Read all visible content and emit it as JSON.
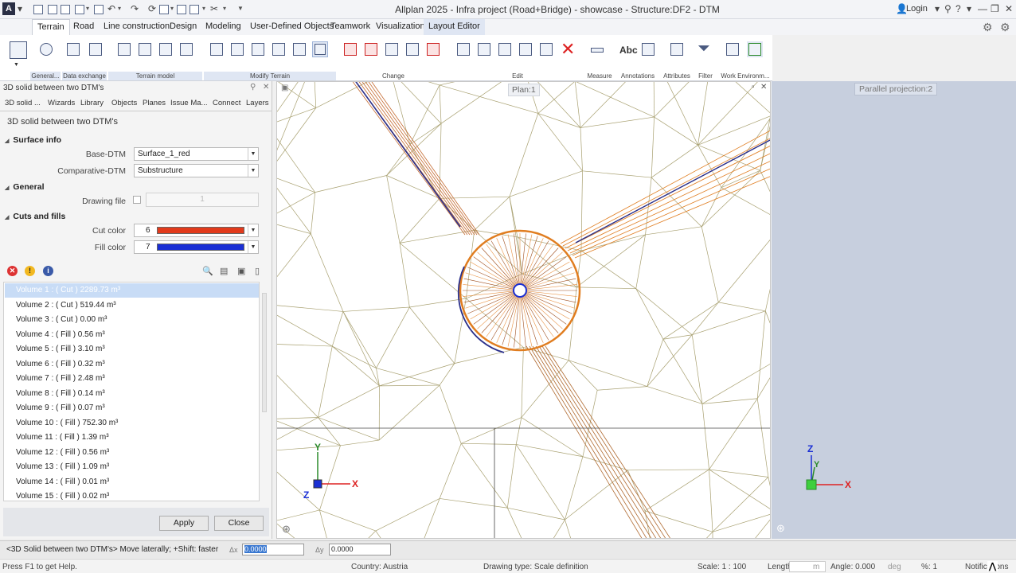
{
  "window": {
    "title": "Allplan 2025 - Infra project (Road+Bridge) - showcase - Structure:DF2 - DTM",
    "login": "Login"
  },
  "ribbon": {
    "tabs": [
      "Terrain",
      "Road",
      "Line construction",
      "Design",
      "Modeling",
      "User-Defined Objects",
      "Teamwork",
      "Visualization",
      "Layout Editor"
    ],
    "active_tab": "Terrain",
    "groups": [
      "General...",
      "Data exchange",
      "Terrain model",
      "Modify Terrain",
      "Change",
      "Edit",
      "Measure",
      "Annotations",
      "Attributes",
      "Filter",
      "Work Environm..."
    ],
    "abc_label": "Abc"
  },
  "panel": {
    "title": "3D solid between two DTM's",
    "tabs": [
      "3D solid ...",
      "Wizards",
      "Library",
      "Objects",
      "Planes",
      "Issue Ma...",
      "Connect",
      "Layers"
    ],
    "heading": "3D solid between two DTM's",
    "sections": {
      "surface_info": "Surface info",
      "general": "General",
      "cuts_fills": "Cuts and fills"
    },
    "fields": {
      "base_dtm_label": "Base-DTM",
      "base_dtm_value": "Surface_1_red",
      "comp_dtm_label": "Comparative-DTM",
      "comp_dtm_value": "Substructure",
      "drawing_file_label": "Drawing file",
      "drawing_file_value": "1",
      "cut_color_label": "Cut color",
      "cut_color_num": "6",
      "cut_color_hex": "#e23a1c",
      "fill_color_label": "Fill color",
      "fill_color_num": "7",
      "fill_color_hex": "#1a2fd4"
    },
    "volumes": [
      "Volume 1 : ( Cut ) 2289.73 m³",
      "Volume 2 : ( Cut ) 519.44 m³",
      "Volume 3 : ( Cut ) 0.00 m³",
      "Volume 4 : ( Fill ) 0.56 m³",
      "Volume 5 : ( Fill ) 3.10 m³",
      "Volume 6 : ( Fill ) 0.32 m³",
      "Volume 7 : ( Fill ) 2.48 m³",
      "Volume 8 : ( Fill ) 0.14 m³",
      "Volume 9 : ( Fill ) 0.07 m³",
      "Volume 10 : ( Fill ) 752.30 m³",
      "Volume 11 : ( Fill ) 1.39 m³",
      "Volume 12 : ( Fill ) 0.56 m³",
      "Volume 13 : ( Fill ) 1.09 m³",
      "Volume 14 : ( Fill ) 0.01 m³",
      "Volume 15 : ( Fill ) 0.02 m³"
    ],
    "apply": "Apply",
    "close": "Close"
  },
  "viewports": {
    "plan_label": "Plan:1",
    "parallel_label": "Parallel projection:2",
    "axis_x": "X",
    "axis_y": "Y",
    "axis_z": "Z"
  },
  "cmdbar": {
    "prompt": "<3D Solid between two DTM's> Move laterally; +Shift: faster",
    "dx_label": "Δx",
    "dx_value": "0.0000",
    "dy_label": "Δy",
    "dy_value": "0.0000"
  },
  "statusbar": {
    "help": "Press F1 to get Help.",
    "country": "Country:  Austria",
    "drawing_type": "Drawing type:  Scale definition",
    "scale": "Scale:  1 : 100",
    "length_label": "Length:",
    "length_value": "m",
    "angle": "Angle:  0.000",
    "angle_unit": "deg",
    "percent": "%:  1",
    "notifications": "Notifications"
  }
}
